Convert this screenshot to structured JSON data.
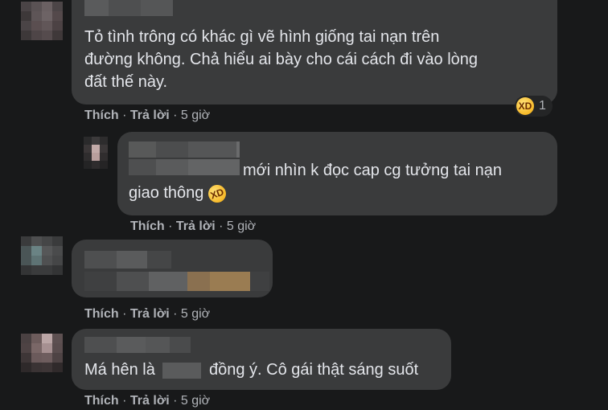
{
  "comments": [
    {
      "text_line1": "Tỏ tình trông có khác gì vẽ hình giống tai nạn trên",
      "text_line2": "đường không. Chả hiểu ai bày cho cái cách đi vào lòng",
      "text_line3": "đất thế này.",
      "reaction_count": "1",
      "like": "Thích",
      "reply": "Trả lời",
      "time": "5 giờ"
    },
    {
      "text_line1": "mới nhìn k đọc cap cg tưởng tai nạn",
      "text_line2": "giao thông",
      "like": "Thích",
      "reply": "Trả lời",
      "time": "5 giờ"
    },
    {
      "like": "Thích",
      "reply": "Trả lời",
      "time": "5 giờ"
    },
    {
      "text_before": "Má hên là",
      "text_after": "đồng ý. Cô gái thật sáng suốt",
      "like": "Thích",
      "reply": "Trả lời",
      "time": "5 giờ"
    }
  ],
  "separator": "·",
  "icons": {
    "reaction": "laughing-reaction-icon",
    "emoji": "rolling-laughing-emoji"
  }
}
